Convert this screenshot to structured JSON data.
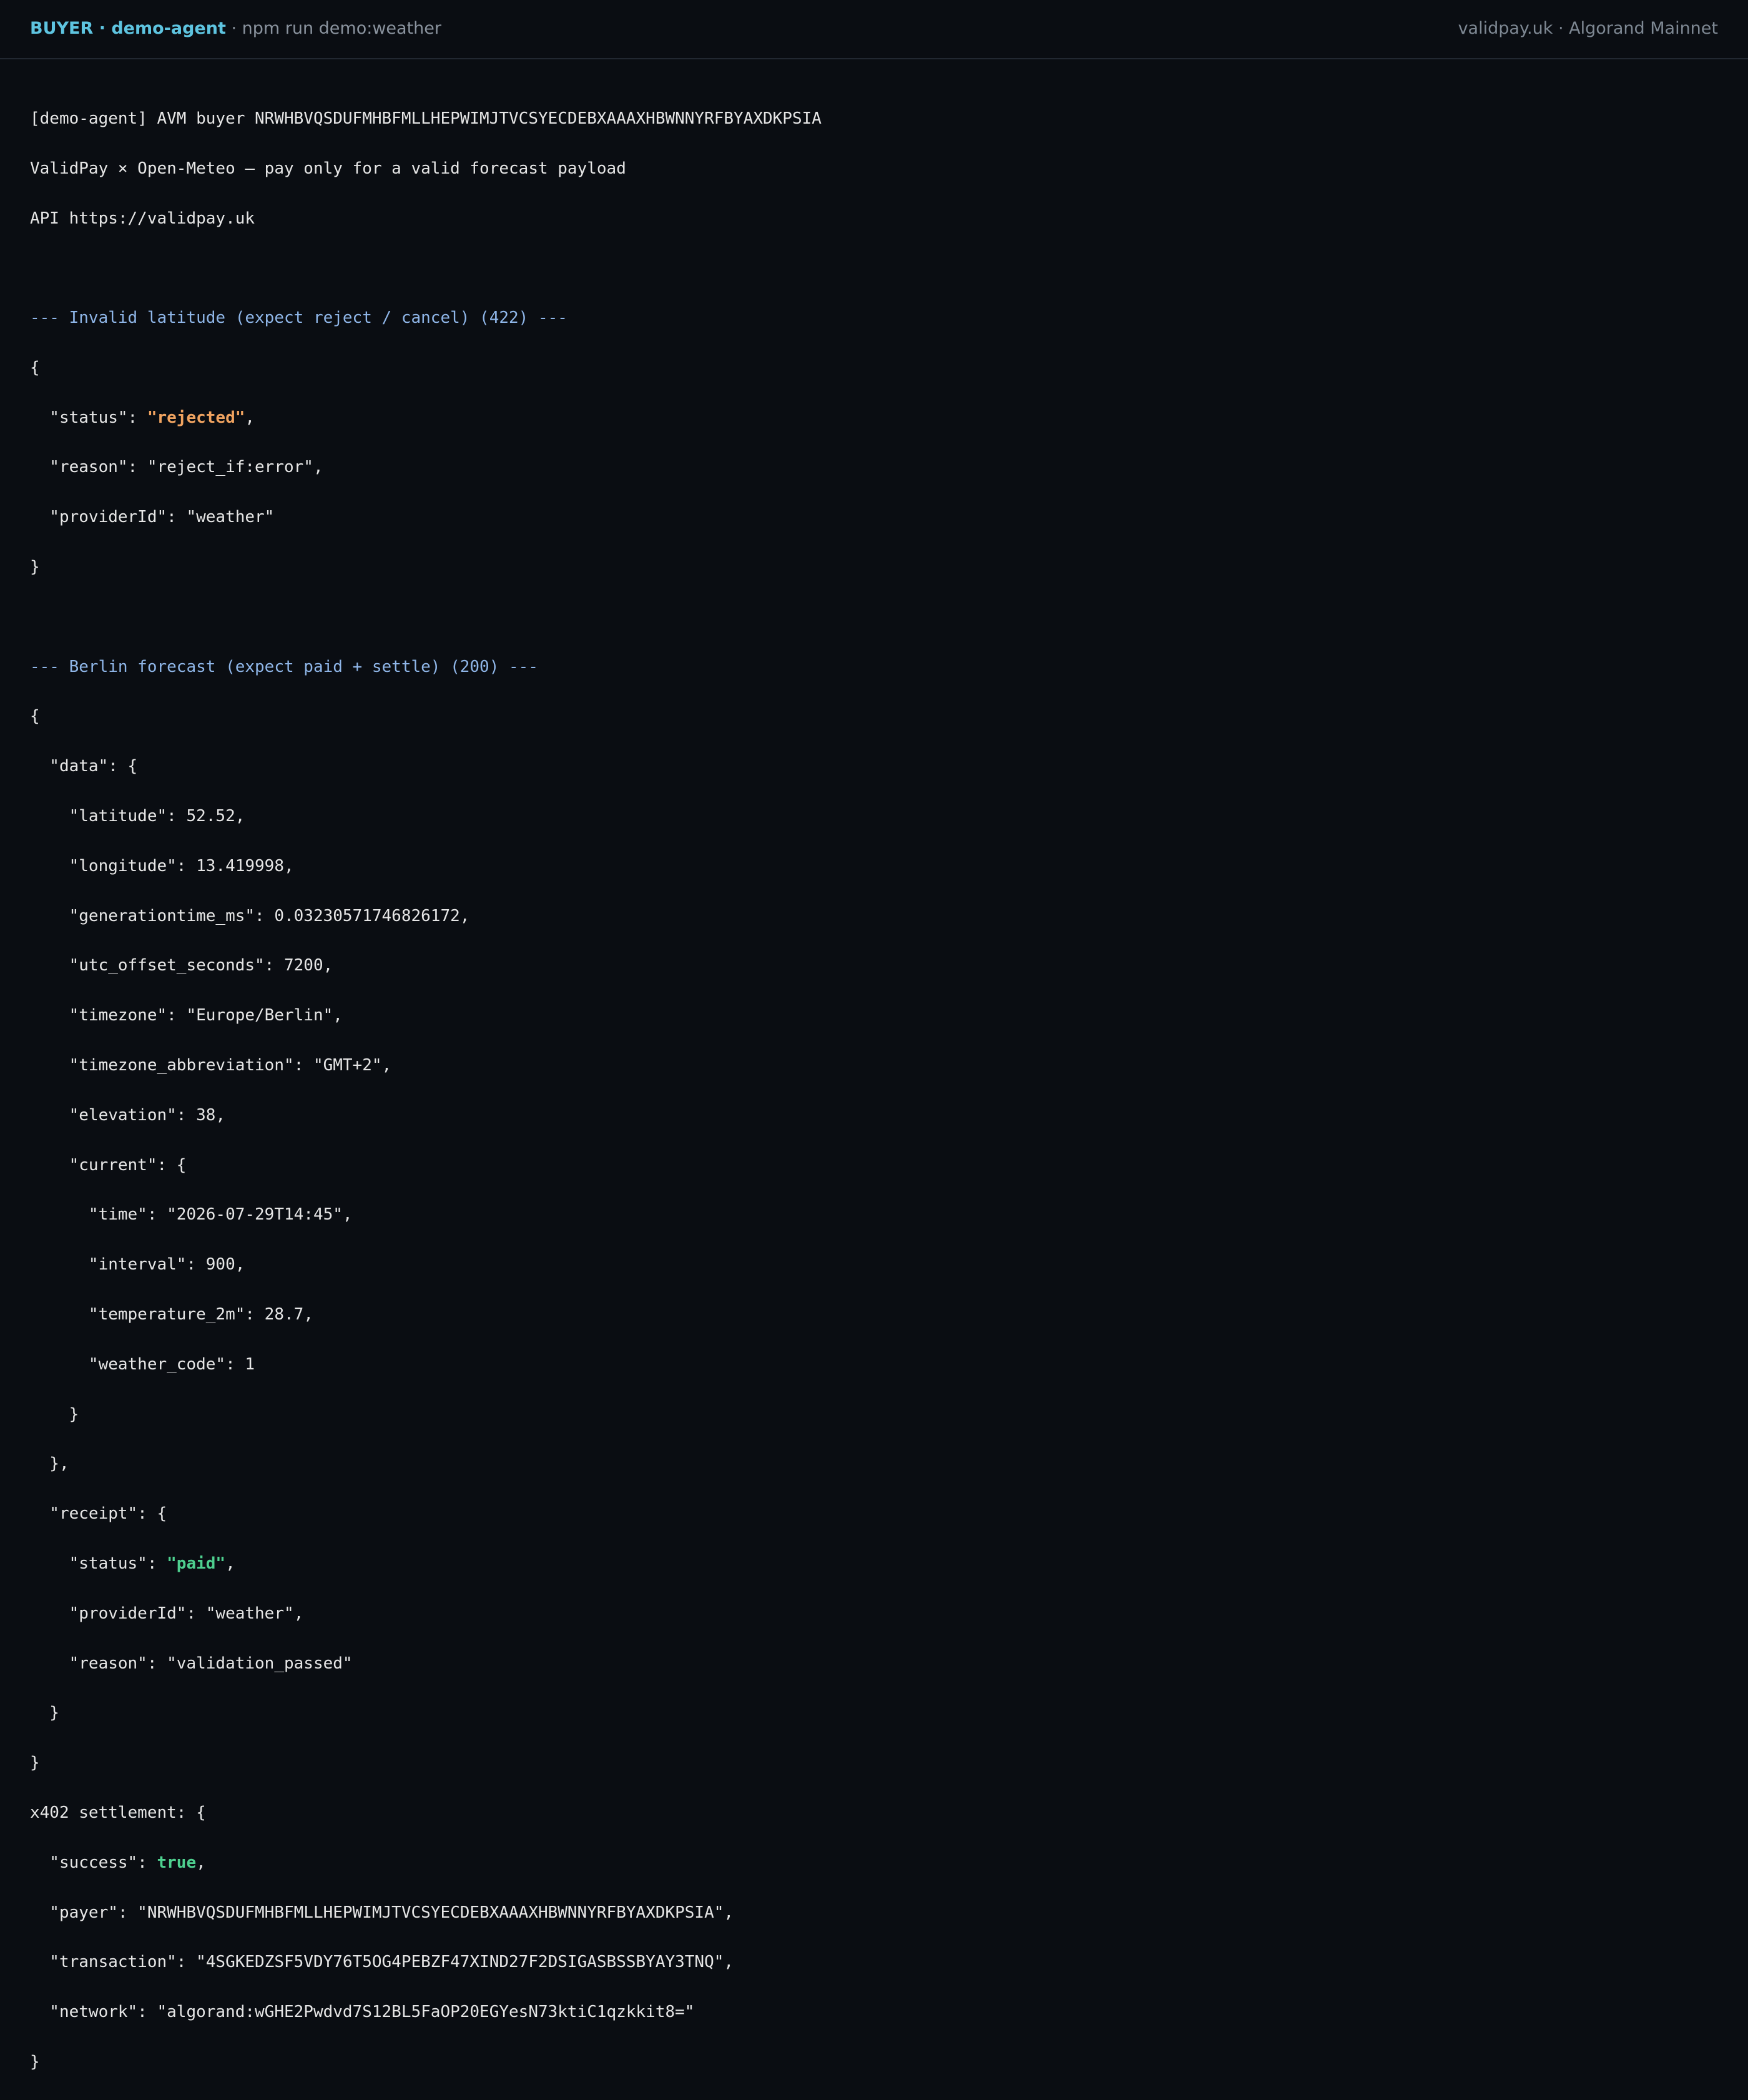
{
  "header": {
    "role": "BUYER",
    "separator": " · ",
    "agent": "demo-agent",
    "command_prefix": " · ",
    "command": "npm run demo:weather",
    "right": "validpay.uk · Algorand Mainnet"
  },
  "intro": {
    "buyer_line": "[demo-agent] AVM buyer NRWHBVQSDUFMHBFMLLHEPWIMJTVCSYECDEBXAAAXHBWNNYRFBYAXDKPSIA",
    "tagline": "ValidPay × Open-Meteo — pay only for a valid forecast payload",
    "api_line": "API https://validpay.uk"
  },
  "invalid": {
    "heading": "--- Invalid latitude (expect reject / cancel) (422) ---",
    "open": "{",
    "status_key": "  \"status\": ",
    "status_value": "\"rejected\"",
    "status_tail": ",",
    "reason": "  \"reason\": \"reject_if:error\",",
    "provider": "  \"providerId\": \"weather\"",
    "close": "}"
  },
  "berlin": {
    "heading": "--- Berlin forecast (expect paid + settle) (200) ---",
    "open": "{",
    "data_open": "  \"data\": {",
    "latitude": "    \"latitude\": 52.52,",
    "longitude": "    \"longitude\": 13.419998,",
    "generationtime": "    \"generationtime_ms\": 0.03230571746826172,",
    "utc_offset": "    \"utc_offset_seconds\": 7200,",
    "timezone": "    \"timezone\": \"Europe/Berlin\",",
    "timezone_abbr": "    \"timezone_abbreviation\": \"GMT+2\",",
    "elevation": "    \"elevation\": 38,",
    "current_open": "    \"current\": {",
    "time": "      \"time\": \"2026-07-29T14:45\",",
    "interval": "      \"interval\": 900,",
    "temperature": "      \"temperature_2m\": 28.7,",
    "weather_code": "      \"weather_code\": 1",
    "current_close": "    }",
    "data_close": "  },",
    "receipt_open": "  \"receipt\": {",
    "receipt_status_key": "    \"status\": ",
    "receipt_status_value": "\"paid\"",
    "receipt_status_tail": ",",
    "receipt_provider": "    \"providerId\": \"weather\",",
    "receipt_reason": "    \"reason\": \"validation_passed\"",
    "receipt_close": "  }",
    "close": "}"
  },
  "settlement": {
    "open": "x402 settlement: {",
    "success_key": "  \"success\": ",
    "success_value": "true",
    "success_tail": ",",
    "payer": "  \"payer\": \"NRWHBVQSDUFMHBFMLLHEPWIMJTVCSYECDEBXAAAXHBWNNYRFBYAXDKPSIA\",",
    "transaction": "  \"transaction\": \"4SGKEDZSF5VDY76T5OG4PEBZF47XIND27F2DSIGASBSSBYAY3TNQ\",",
    "network": "  \"network\": \"algorand:wGHE2Pwdvd7S12BL5FaOP20EGYesN73ktiC1qzkkit8=\"",
    "close": "}"
  },
  "colors": {
    "background": "#0a0d12",
    "accent": "#5ec4e0",
    "section_heading": "#8fb6e8",
    "rejected": "#f0a360",
    "paid": "#4ed08f"
  }
}
